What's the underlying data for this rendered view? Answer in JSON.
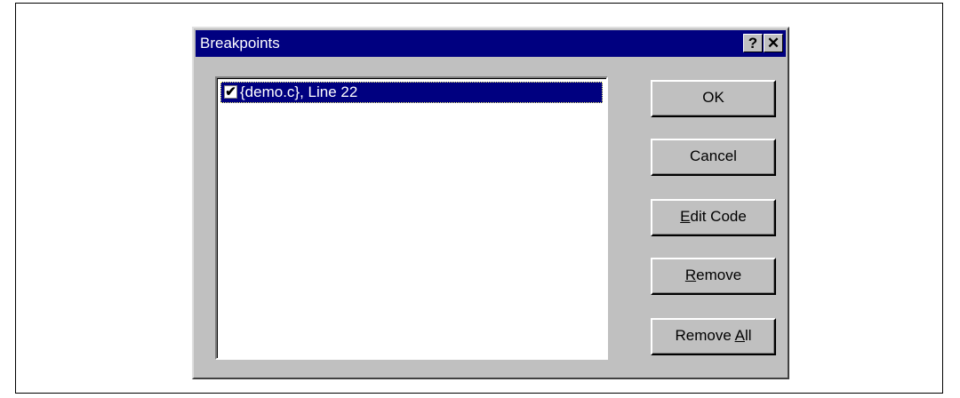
{
  "dialog": {
    "title": "Breakpoints",
    "help_label": "?",
    "close_label": "✕"
  },
  "breakpoints": [
    {
      "checked": true,
      "label": "{demo.c}, Line 22"
    }
  ],
  "buttons": {
    "ok": {
      "pre": "OK",
      "accel": "",
      "post": ""
    },
    "cancel": {
      "pre": "Cancel",
      "accel": "",
      "post": ""
    },
    "edit_code": {
      "pre": "",
      "accel": "E",
      "post": "dit Code"
    },
    "remove": {
      "pre": "",
      "accel": "R",
      "post": "emove"
    },
    "remove_all": {
      "pre": "Remove ",
      "accel": "A",
      "post": "ll"
    }
  },
  "colors": {
    "titlebar": "#000080",
    "face": "#c0c0c0",
    "selection": "#000080"
  }
}
